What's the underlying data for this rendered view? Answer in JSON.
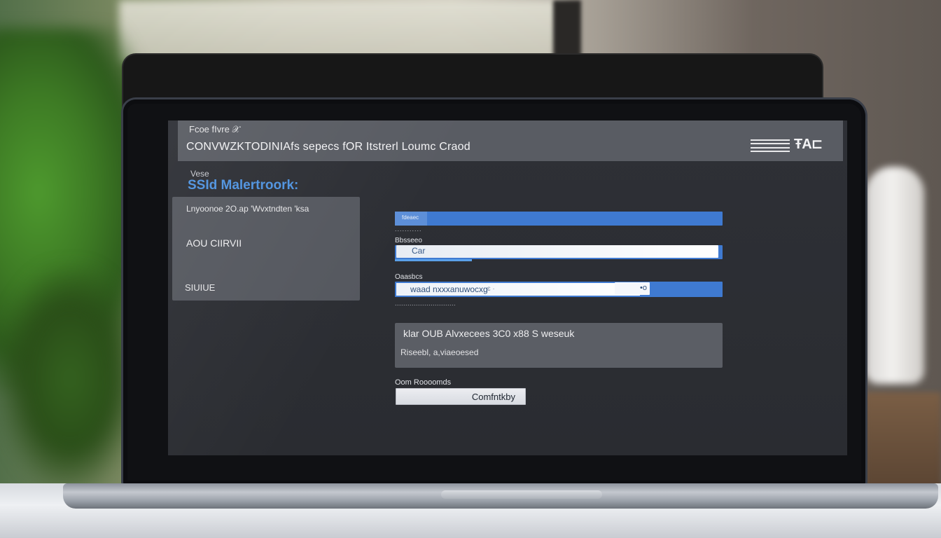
{
  "header": {
    "crumb": "Fcoe fIvre 𝒳",
    "title": "CONVWZKTODINIAfs sepecs  fOR  Itstrerl Loumc Craod",
    "menu_icon": "hamburger-icon",
    "brand_icon_text": "ŦA⊏"
  },
  "page": {
    "breadcrumb": "Vese",
    "title": "SSId Malertroork:"
  },
  "left_card": {
    "header": "Lnyoonoe  2O.ap  'Wvxtndten 'ksa",
    "value": "AOU CIIRVII",
    "status": "SIUIUE"
  },
  "form": {
    "field1": {
      "label": "fdeaec",
      "hint": "..........."
    },
    "field2": {
      "label": "Bbsseeo",
      "value": "Car"
    },
    "field3": {
      "label": "Oaasbcs",
      "value": "waad nxxxanuwocxg",
      "count": "ɛ ·",
      "knob": "•o",
      "hint": "............................."
    },
    "info": {
      "title": "klar  OUB  Alvxecees  3C0  x88  S  weseuk",
      "subtitle": "Riseebl,   a,viaeoesed"
    },
    "confirm": {
      "label": "Oom Roooomds",
      "button": "Comfntkby"
    }
  },
  "colors": {
    "accent": "#3f7ad1",
    "title_blue": "#4f93e0",
    "screen_bg": "#2e3036",
    "titlebar": "#595c63"
  }
}
